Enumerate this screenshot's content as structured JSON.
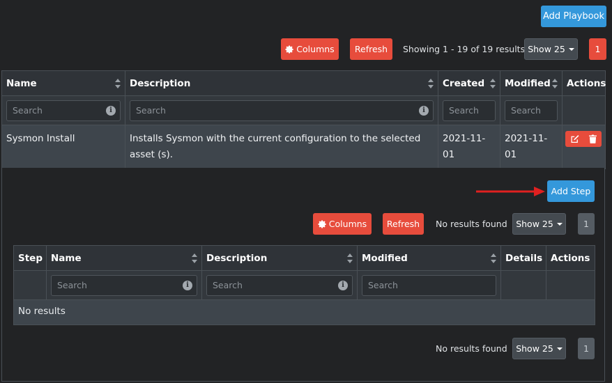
{
  "toolbar": {
    "add_playbook": "Add Playbook",
    "columns": "Columns",
    "refresh": "Refresh",
    "showing": "Showing 1 - 19 of 19 results",
    "show": "Show 25",
    "page": "1"
  },
  "playbooks": {
    "headers": [
      "Name",
      "Description",
      "Created",
      "Modified",
      "Actions"
    ],
    "search_placeholder": "Search",
    "rows": [
      {
        "name": "Sysmon Install",
        "description": "Installs Sysmon with the current configuration to the selected asset (s).",
        "created": "2021-11-01",
        "modified": "2021-11-01"
      }
    ]
  },
  "steps": {
    "add_step": "Add Step",
    "columns": "Columns",
    "refresh": "Refresh",
    "status": "No results found",
    "show": "Show 25",
    "page": "1",
    "headers": [
      "Step",
      "Name",
      "Description",
      "Modified",
      "Details",
      "Actions"
    ],
    "search_placeholder": "Search",
    "no_results": "No results",
    "footer_status": "No results found",
    "footer_show": "Show 25",
    "footer_page": "1"
  },
  "colors": {
    "background": "#222325",
    "primary": "#3498db",
    "danger": "#e74c3c",
    "arrow": "#e02020"
  },
  "icons": [
    "gear-icon",
    "edit-icon",
    "trash-icon",
    "info-icon",
    "sort-icon",
    "arrow-right-icon"
  ]
}
